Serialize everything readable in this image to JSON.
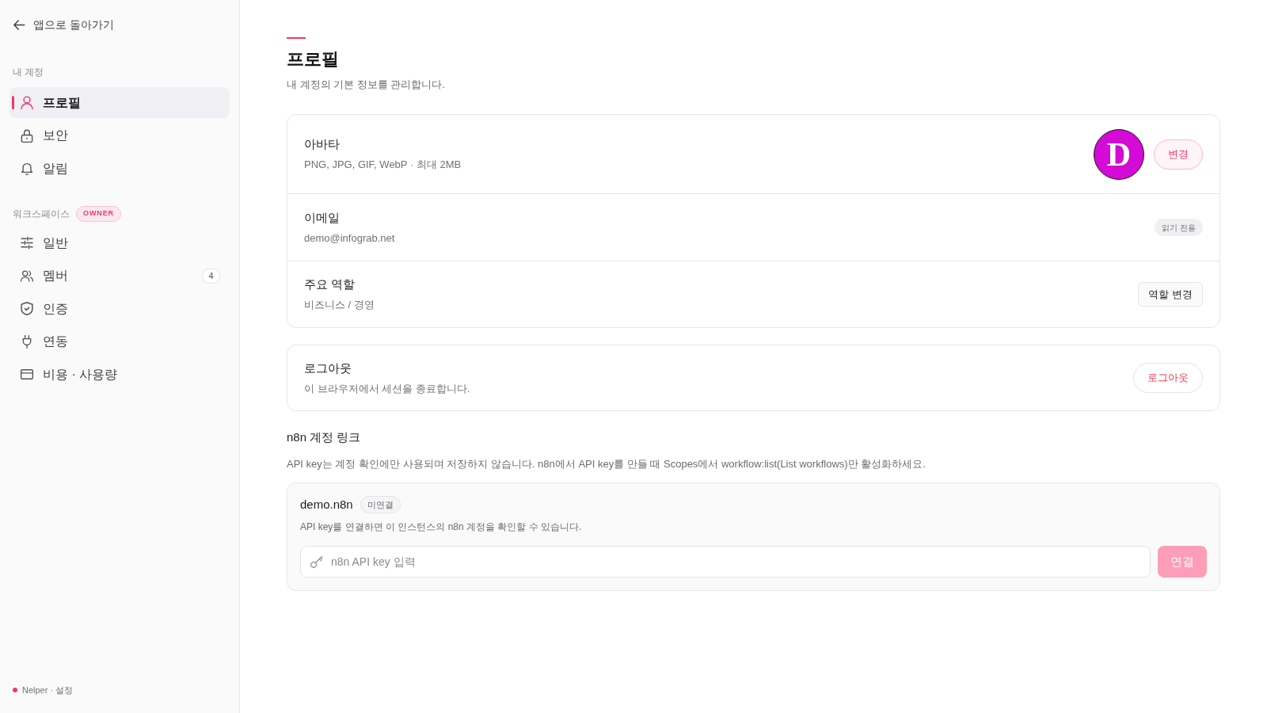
{
  "sidebar": {
    "back_link": "앱으로 돌아가기",
    "sections": [
      {
        "label": "내 계정",
        "items": [
          {
            "label": "프로필",
            "selected": true
          },
          {
            "label": "보안",
            "selected": false
          },
          {
            "label": "알림",
            "selected": false
          }
        ]
      },
      {
        "label": "워크스페이스",
        "badge": "OWNER",
        "items": [
          {
            "label": "일반",
            "selected": false
          },
          {
            "label": "멤버",
            "selected": false,
            "count": "4"
          },
          {
            "label": "인증",
            "selected": false
          },
          {
            "label": "연동",
            "selected": false
          },
          {
            "label": "비용 · 사용량",
            "selected": false
          }
        ]
      }
    ],
    "footer": "Nelper · 설정"
  },
  "page": {
    "title": "프로필",
    "subtitle": "내 계정의 기본 정보를 관리합니다."
  },
  "profile_card": {
    "rows": [
      {
        "kind": "avatar",
        "label": "아바타",
        "value": "PNG, JPG, GIF, WebP · 최대 2MB",
        "avatar": "D",
        "button": "변경"
      },
      {
        "kind": "badge",
        "label": "이메일",
        "value": "demo@infograb.net",
        "badge": "읽기 전용"
      },
      {
        "kind": "button",
        "label": "주요 역할",
        "value": "비즈니스 / 경영",
        "button": "역할 변경"
      }
    ]
  },
  "logout_card": {
    "label": "로그아웃",
    "value": "이 브라우저에서 세션을 종료합니다.",
    "button": "로그아웃"
  },
  "n8n_link": {
    "title": "n8n 계정 링크",
    "description": "API key는 계정 확인에만 사용되며 저장하지 않습니다. n8n에서 API key를 만들 때 Scopes에서 workflow:list(List workflows)만 활성화하세요.",
    "instance": {
      "name": "demo.n8n",
      "status": "미연결",
      "description": "API key를 연결하면 이 인스턴스의 n8n 계정을 확인할 수 있습니다.",
      "input": {
        "placeholder": "n8n API key 입력"
      },
      "connect_button": {
        "label": "연결",
        "disabled": true
      }
    }
  }
}
